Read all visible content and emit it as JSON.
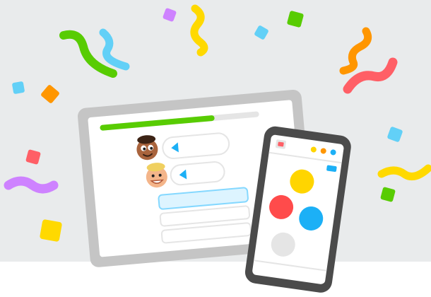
{
  "illustration": {
    "theme": "celebration-confetti-devices",
    "colors": {
      "backdrop": "#E9EBEC",
      "floor": "#FFFFFF",
      "device_frame": "#C5C5C5",
      "phone_frame": "#4B4B4B",
      "progress_fill": "#58CC02",
      "progress_track": "#E5E5E5",
      "speaker_icon": "#1CB0F6",
      "selected_option_fill": "#DDF4FF",
      "selected_option_border": "#84D8FF",
      "confetti_green": "#58CC02",
      "confetti_blue": "#62D0F7",
      "confetti_yellow": "#FFD900",
      "confetti_orange": "#FF9600",
      "confetti_red": "#FF5F66",
      "confetti_purple": "#CE82FF",
      "dot_yellow": "#FFD500",
      "dot_red": "#FF4B4B",
      "dot_blue": "#1CB0F6",
      "dot_gray": "#E5E5E5"
    },
    "tablet": {
      "progress": 0.72,
      "chat_rows": [
        {
          "character": "brown-haired-character-avatar",
          "icon": "speaker-icon"
        },
        {
          "character": "blond-character-avatar",
          "icon": "speaker-icon"
        }
      ],
      "answer_options": [
        {
          "state": "selected"
        },
        {
          "state": "default"
        },
        {
          "state": "default"
        },
        {
          "state": "default"
        }
      ]
    },
    "phone": {
      "header_icons": [
        "flag-icon",
        "yellow-dot-icon",
        "orange-dot-icon",
        "blue-dot-icon"
      ],
      "button": "blue-action-button",
      "choices": [
        "yellow",
        "red",
        "blue",
        "gray"
      ]
    }
  }
}
